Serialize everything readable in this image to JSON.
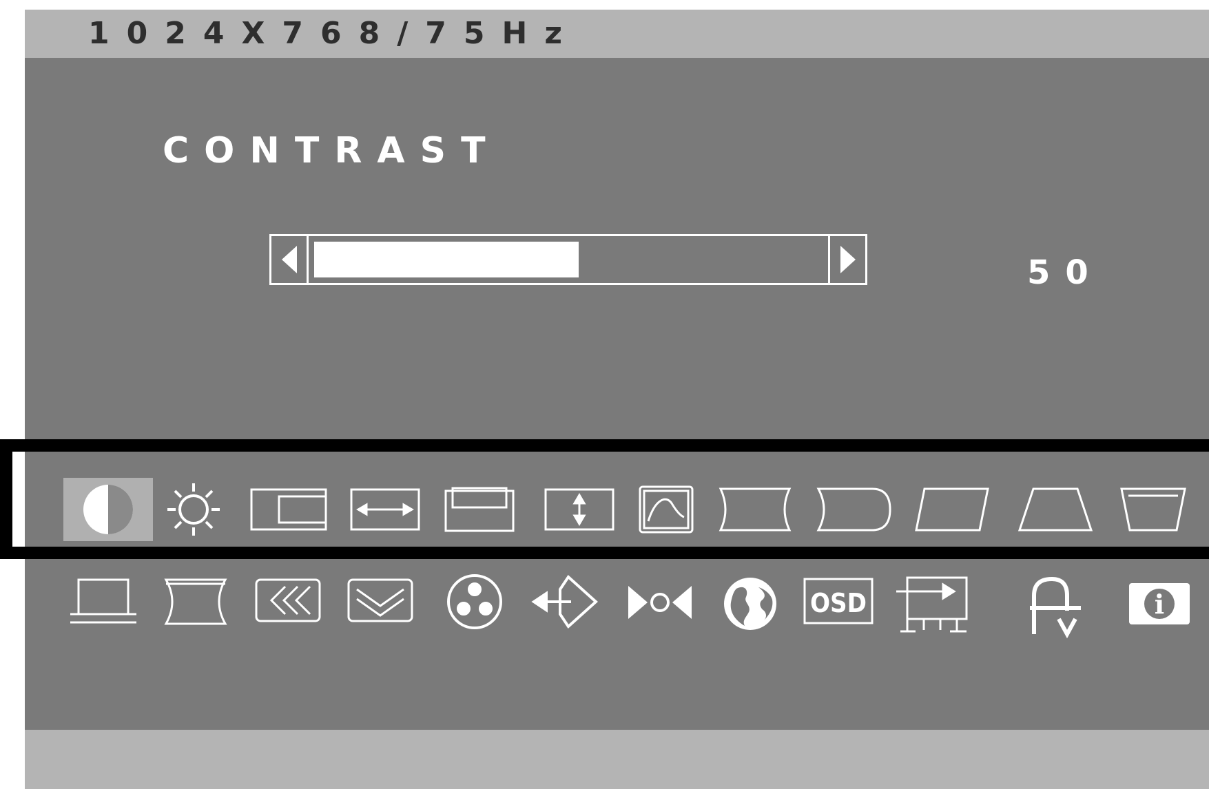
{
  "header": {
    "timing": "1024X768/75Hz"
  },
  "menu": {
    "title": "CONTRAST",
    "value": "50",
    "level_fraction": 0.52
  },
  "icons_row1": [
    "contrast-icon",
    "brightness-icon",
    "h-position-icon",
    "h-size-icon",
    "v-position-icon",
    "v-size-icon",
    "geometry-icon",
    "pincushion-icon",
    "pin-balance-icon",
    "parallelogram-icon",
    "trapezoid-top-icon",
    "trapezoid-bottom-icon"
  ],
  "icons_row2": [
    "top-corner-icon",
    "bottom-corner-icon",
    "moire-h-icon",
    "moire-v-icon",
    "color-icon",
    "input-select-icon",
    "degauss-icon",
    "language-icon",
    "osd-icon",
    "osd-position-icon",
    "recall-icon",
    "information-icon"
  ],
  "labels": {
    "osd": "OSD",
    "info": "i"
  }
}
